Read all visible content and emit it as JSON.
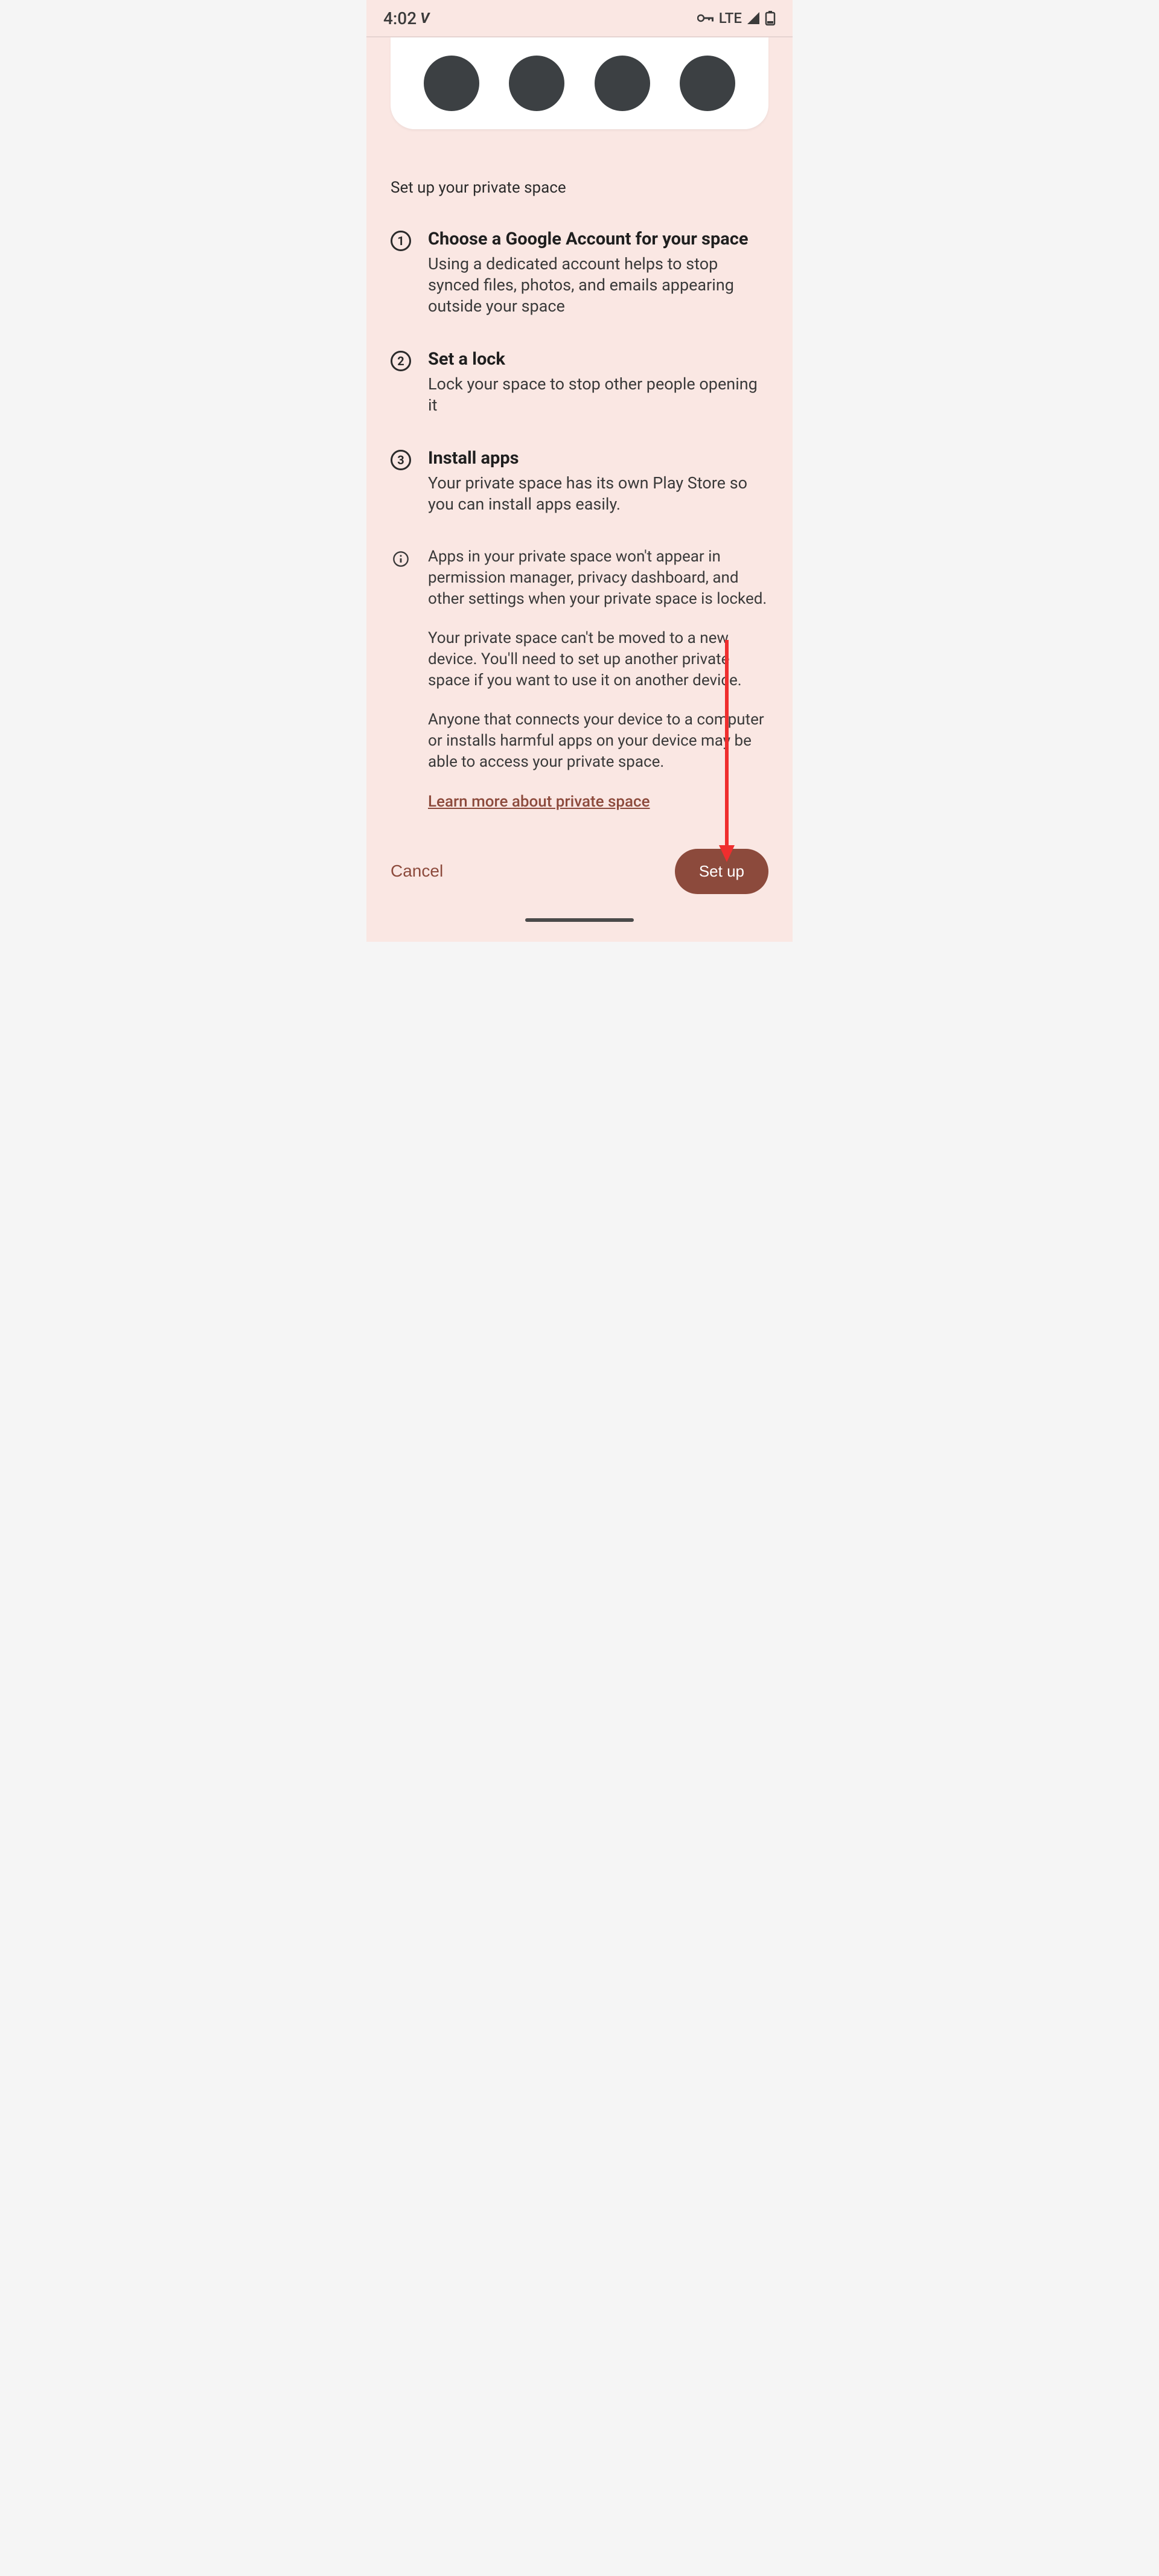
{
  "status_bar": {
    "time": "4:02",
    "network_label": "LTE"
  },
  "section_title": "Set up your private space",
  "steps": [
    {
      "number": "1",
      "title": "Choose a Google Account for your space",
      "desc": "Using a dedicated account helps to stop synced files, photos, and emails appearing outside your space"
    },
    {
      "number": "2",
      "title": "Set a lock",
      "desc": "Lock your space to stop other people opening it"
    },
    {
      "number": "3",
      "title": "Install apps",
      "desc": "Your private space has its own Play Store so you can install apps easily."
    }
  ],
  "info": {
    "para1": "Apps in your private space won't appear in permission manager, privacy dashboard, and other settings when your private space is locked.",
    "para2": "Your private space can't be moved to a new device. You'll need to set up another private space if you want to use it on another device.",
    "para3": "Anyone that connects your device to a computer or installs harmful apps on your device may be able to access your private space.",
    "learn_more": "Learn more about private space"
  },
  "buttons": {
    "cancel": "Cancel",
    "setup": "Set up"
  }
}
